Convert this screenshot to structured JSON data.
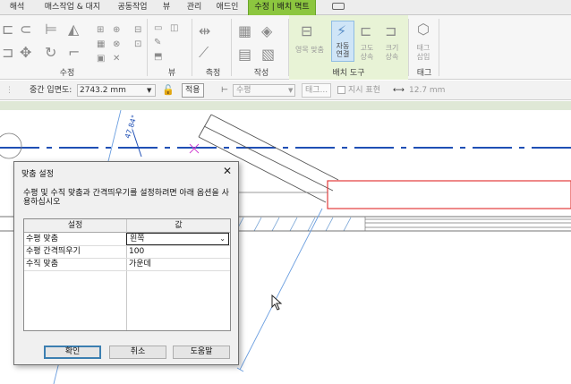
{
  "tabs": [
    {
      "label": "해석"
    },
    {
      "label": "매스작업 & 대지"
    },
    {
      "label": "공동작업"
    },
    {
      "label": "뷰"
    },
    {
      "label": "관리"
    },
    {
      "label": "애드인"
    },
    {
      "label": "수정 | 배치 멱트"
    }
  ],
  "ribbon": {
    "panels": {
      "modify": "수정",
      "view": "뷰",
      "measure": "측정",
      "create": "작성",
      "placement_tools": "배치 도구",
      "tag": "태그"
    },
    "buttons": {
      "align_group": "영목 맞춤",
      "auto_connect": "자동\n연결",
      "height_line1": "고도",
      "height_line2": "상속",
      "size_line1": "크기",
      "size_line2": "상속",
      "tag_line1": "태그",
      "tag_line2": "삽입"
    }
  },
  "options_bar": {
    "middle_elevation_label": "중간 입면도:",
    "middle_elevation_value": "2743.2 mm",
    "apply_button": "적용",
    "justification_value": "수평",
    "tag_button": "태그...",
    "show_ref_label": "지시 표현",
    "length_value": "12.7 mm"
  },
  "canvas": {
    "angle_label": "47.84°"
  },
  "dialog": {
    "title": "맞춤 설정",
    "description": "수평 및 수직 맞춤과 간격띄우기를 설정하려면 아래 옵션을 사용하십시오",
    "col_setting": "설정",
    "col_value": "값",
    "rows": [
      {
        "setting": "수평 맞춤",
        "value": "왼쪽"
      },
      {
        "setting": "수평 간격띄우기",
        "value": "100"
      },
      {
        "setting": "수직 맞춤",
        "value": "가운데"
      }
    ],
    "ok_button": "확인",
    "cancel_button": "취소",
    "help_button": "도움말"
  },
  "colors": {
    "active_tab": "#8cc63f",
    "ribbon_context": "#e8f3d6",
    "dialog_default_border": "#3c7fb1",
    "grid_line_blue": "#1f4fb5",
    "selection_red": "#e23b3b"
  }
}
